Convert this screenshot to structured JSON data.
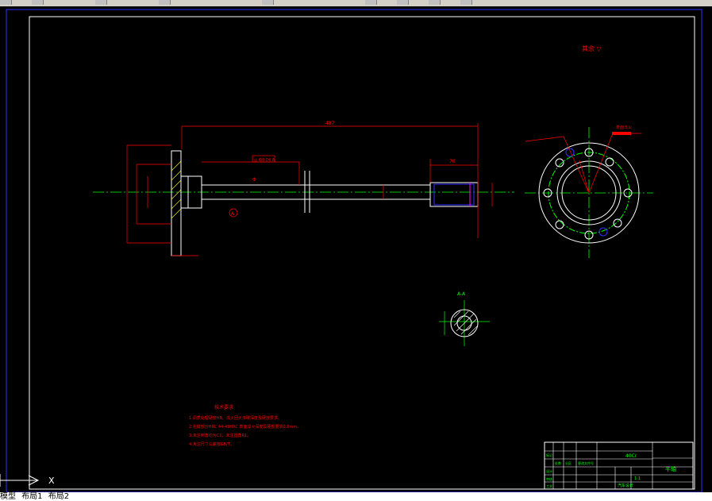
{
  "model_space": {
    "notes_title": "技术要求",
    "notes": [
      "1.调质处理硬度HB。淬火回火渗碳深度及硬度要求。",
      "2.花键部分HRC 44-48HRC 表面淬火深度及硬度要求0.8mm。",
      "3.未注倒角均为C1，未注圆角R1。",
      "4.未注尺寸公差按GB/T。"
    ],
    "roughness_note": "其余 ▽",
    "section_label": "A-A",
    "datum_callout": "A",
    "flange_tag": "表面淬火",
    "dims": {
      "overall_length": "487",
      "spline_len": "70",
      "shaft_dia": "Φ",
      "tol_frame": "◎ Φ0.04 A"
    },
    "title_block": {
      "part_name": "半轴",
      "company": "汽车设计",
      "scale": "1:1",
      "sheet": "共1张 第1张",
      "material": "40Cr",
      "rows": [
        "标记",
        "处数",
        "分区",
        "更改文件号",
        "签名",
        "年月日"
      ],
      "left_rows": [
        "设计",
        "审核",
        "工艺",
        "批准"
      ]
    }
  },
  "ucs": {
    "x_label": "X"
  },
  "layout_tabs": [
    "模型",
    "布局1",
    "布局2"
  ],
  "colors": {
    "background": "#000000",
    "outline": "#ffffff",
    "dimension": "#ff0000",
    "center": "#00ff00",
    "frame": "#0000ff",
    "text_note": "#ff0000",
    "hidden": "#ffff00"
  }
}
